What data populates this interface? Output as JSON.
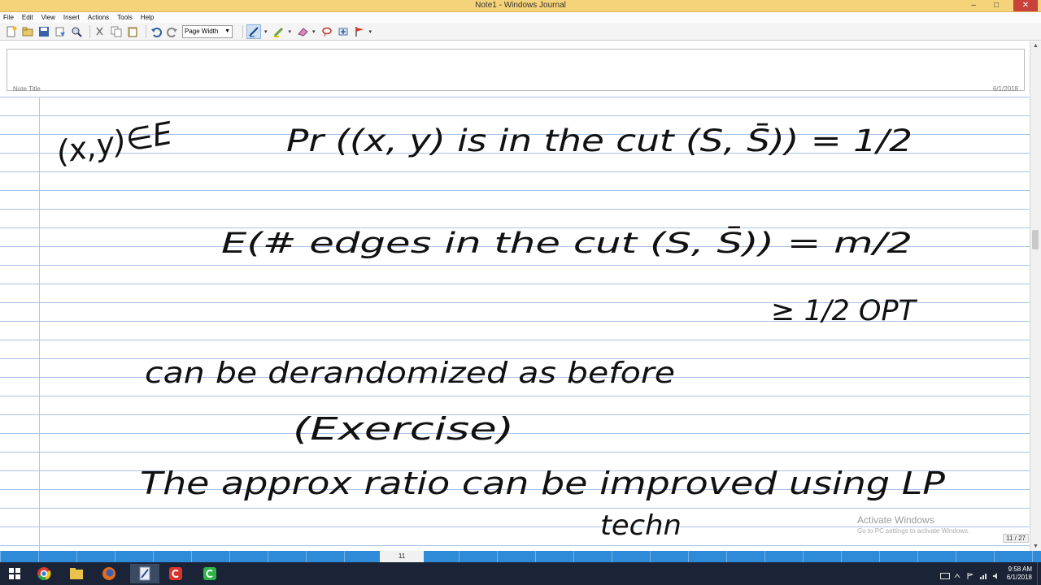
{
  "window": {
    "title": "Note1 - Windows Journal",
    "minimize": "–",
    "maximize": "□",
    "close": "✕"
  },
  "menu": [
    "File",
    "Edit",
    "View",
    "Insert",
    "Actions",
    "Tools",
    "Help"
  ],
  "toolbar": {
    "zoom": "Page Width",
    "icons": [
      "new-note-icon",
      "open-icon",
      "save-icon",
      "send-icon",
      "find-icon",
      "cut-icon",
      "copy-icon",
      "paste-icon",
      "undo-icon",
      "redo-icon"
    ],
    "pen_tools": [
      "pen-icon",
      "highlighter-icon",
      "eraser-icon",
      "lasso-icon",
      "insert-space-icon",
      "flag-icon"
    ]
  },
  "note": {
    "title_label": "Note Title",
    "date": "6/1/2018",
    "handwriting": [
      "(x,y)∈E",
      "Pr ((x, y) is in the cut (S, S̄)) = 1/2",
      "E(# edges in the cut (S, S̄)) = m/2",
      "≥ 1/2 OPT",
      "can be derandomized as before",
      "(Exercise)",
      "The approx ratio can be improved using LP",
      "techn"
    ]
  },
  "watermark": {
    "line1": "Activate Windows",
    "line2": "Go to PC settings to activate Windows."
  },
  "pager": {
    "indicator": "11 / 27",
    "current": "11"
  },
  "taskbar": {
    "apps": [
      "windows-start-icon",
      "chrome-icon",
      "file-explorer-icon",
      "firefox-icon",
      "red-c-app-icon",
      "journal-icon",
      "green-c-app-icon"
    ],
    "time": "9:58 AM",
    "date": "6/1/2018"
  },
  "colors": {
    "accent": "#2f8ad8",
    "titlebar": "#f5d37a",
    "ink": "#111111",
    "rule": "#a9c4e6"
  }
}
